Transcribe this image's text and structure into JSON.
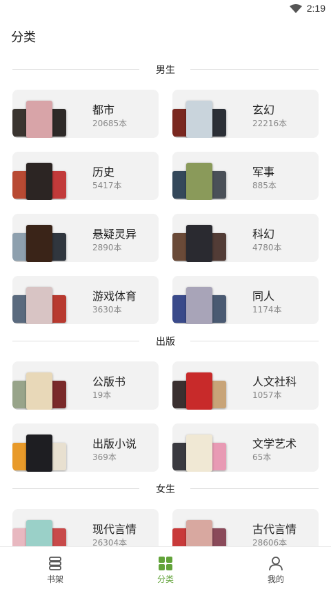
{
  "status": {
    "time": "2:19",
    "wifi_icon": "wifi-icon"
  },
  "page": {
    "title": "分类"
  },
  "sections": [
    {
      "label": "男生",
      "items": [
        {
          "name": "都市",
          "count": "20685本",
          "covers": [
            "#3a3530",
            "#d8a4a8",
            "#2e2a28"
          ]
        },
        {
          "name": "玄幻",
          "count": "22216本",
          "covers": [
            "#7a2820",
            "#c9d4dc",
            "#2b2f36"
          ]
        },
        {
          "name": "历史",
          "count": "5417本",
          "covers": [
            "#b84a33",
            "#2c2523",
            "#c23a3a"
          ]
        },
        {
          "name": "军事",
          "count": "885本",
          "covers": [
            "#34485a",
            "#8a9a5a",
            "#4a5058"
          ]
        },
        {
          "name": "悬疑灵异",
          "count": "2890本",
          "covers": [
            "#8ea0ae",
            "#3a2418",
            "#30363e"
          ]
        },
        {
          "name": "科幻",
          "count": "4780本",
          "covers": [
            "#6a4a38",
            "#2a2a30",
            "#523c36"
          ]
        },
        {
          "name": "游戏体育",
          "count": "3630本",
          "covers": [
            "#5a6a7e",
            "#d8c4c4",
            "#b83a30"
          ]
        },
        {
          "name": "同人",
          "count": "1174本",
          "covers": [
            "#3a4a8a",
            "#a8a4b8",
            "#4a5a72"
          ]
        }
      ]
    },
    {
      "label": "出版",
      "items": [
        {
          "name": "公版书",
          "count": "19本",
          "covers": [
            "#98a48a",
            "#e8d8b8",
            "#7a2a2a"
          ]
        },
        {
          "name": "人文社科",
          "count": "1057本",
          "covers": [
            "#3a3030",
            "#c82a2a",
            "#c8a478"
          ]
        },
        {
          "name": "出版小说",
          "count": "369本",
          "covers": [
            "#e89a2a",
            "#1e1e22",
            "#e8e0d0"
          ]
        },
        {
          "name": "文学艺术",
          "count": "65本",
          "covers": [
            "#3a3a40",
            "#f0e8d4",
            "#e89ab4"
          ]
        }
      ]
    },
    {
      "label": "女生",
      "items": [
        {
          "name": "现代言情",
          "count": "26304本",
          "covers": [
            "#e8b8c0",
            "#9ad0c8",
            "#c84a4a"
          ]
        },
        {
          "name": "古代言情",
          "count": "28606本",
          "covers": [
            "#c83a3a",
            "#d8a8a0",
            "#8a4a5a"
          ]
        }
      ]
    }
  ],
  "tabbar": {
    "tabs": [
      {
        "label": "书架",
        "icon": "bookshelf-icon",
        "active": false
      },
      {
        "label": "分类",
        "icon": "category-grid-icon",
        "active": true
      },
      {
        "label": "我的",
        "icon": "profile-icon",
        "active": false
      }
    ],
    "active_color": "#62a33a"
  }
}
